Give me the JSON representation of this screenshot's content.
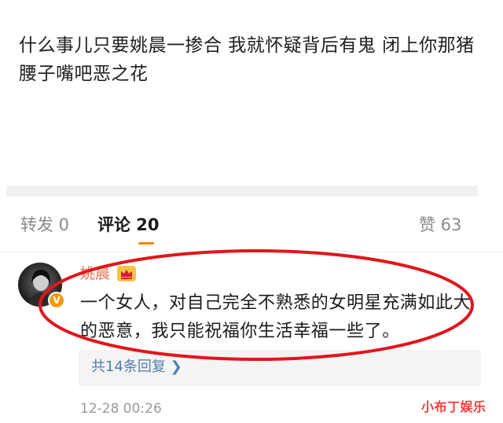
{
  "post": {
    "text": "什么事儿只要姚晨一掺合 我就怀疑背后有鬼 闭上你那猪腰子嘴吧恶之花"
  },
  "tabs": {
    "repost": "转发 0",
    "comments": "评论 20",
    "likes": "赞 63"
  },
  "comment": {
    "username": "姚晨",
    "verified_badge": "V",
    "text": "一个女人，对自己完全不熟悉的女明星充满如此大的恶意，我只能祝福你生活幸福一些了。",
    "replies_link": "共14条回复 ❯",
    "timestamp": "12-28 00:26"
  },
  "watermark": "小布丁娱乐",
  "colors": {
    "accent_orange": "#ff8200",
    "username": "#eb7350",
    "link_blue": "#507daf",
    "annotation_red": "#e0161c"
  },
  "icons": {
    "avatar_badge": "verified-icon",
    "member": "crown-icon",
    "replies_arrow": "chevron-right-icon"
  }
}
